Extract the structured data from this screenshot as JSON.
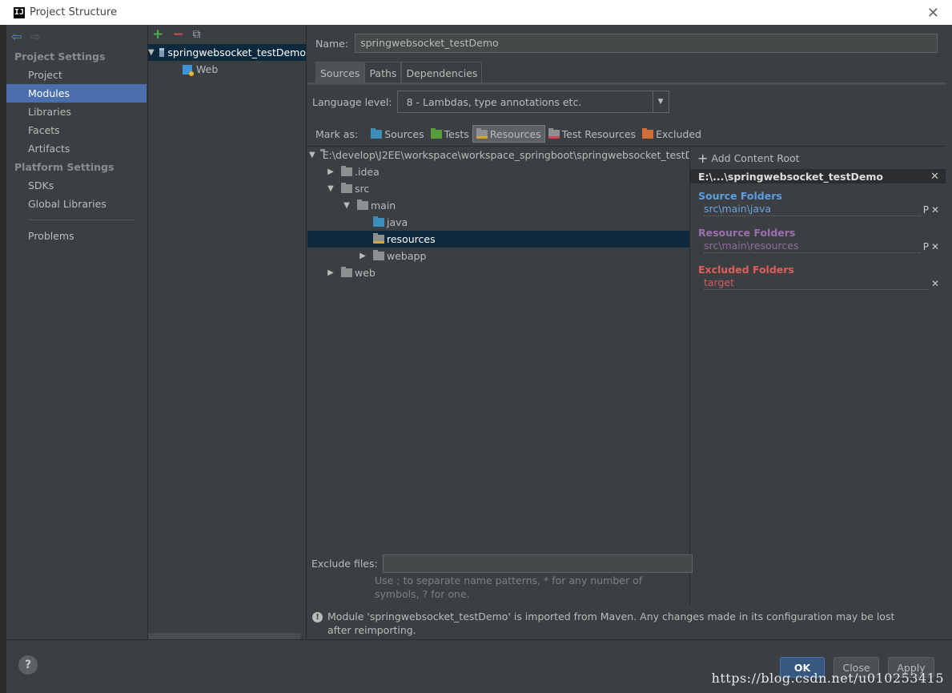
{
  "window": {
    "title": "Project Structure",
    "app_icon": "IJ"
  },
  "nav": {
    "sections": [
      {
        "title": "Project Settings",
        "items": [
          "Project",
          "Modules",
          "Libraries",
          "Facets",
          "Artifacts"
        ]
      },
      {
        "title": "Platform Settings",
        "items": [
          "SDKs",
          "Global Libraries"
        ]
      }
    ],
    "extra_items": [
      "Problems"
    ],
    "selected": "Modules"
  },
  "modules": {
    "toolbar": {
      "add": "+",
      "remove": "−",
      "copy": "⧉"
    },
    "tree": [
      {
        "label": "springwebsocket_testDemo",
        "expanded": true,
        "selected": true
      },
      {
        "label": "Web",
        "indent": 1
      }
    ]
  },
  "module": {
    "name_label": "Name:",
    "name_value": "springwebsocket_testDemo",
    "tabs": [
      "Sources",
      "Paths",
      "Dependencies"
    ],
    "active_tab": "Sources",
    "language_level_label": "Language level:",
    "language_level_value": "8 - Lambdas, type annotations etc.",
    "mark_as_label": "Mark as:",
    "mark_as": [
      "Sources",
      "Tests",
      "Resources",
      "Test Resources",
      "Excluded"
    ],
    "mark_as_selected": "Resources",
    "content_tree": [
      {
        "label": "E:\\develop\\J2EE\\workspace\\workspace_springboot\\springwebsocket_testD",
        "depth": 0,
        "toggle": "down"
      },
      {
        "label": ".idea",
        "depth": 1,
        "toggle": "right"
      },
      {
        "label": "src",
        "depth": 1,
        "toggle": "down"
      },
      {
        "label": "main",
        "depth": 2,
        "toggle": "down"
      },
      {
        "label": "java",
        "depth": 3,
        "toggle": "",
        "kind": "source"
      },
      {
        "label": "resources",
        "depth": 3,
        "toggle": "",
        "kind": "resource",
        "selected": true
      },
      {
        "label": "webapp",
        "depth": 3,
        "toggle": "right"
      },
      {
        "label": "web",
        "depth": 1,
        "toggle": "right"
      }
    ],
    "exclude_files_label": "Exclude files:",
    "exclude_files_value": "",
    "exclude_hint": "Use ; to separate name patterns, * for any number of symbols, ? for one.",
    "warning": "Module 'springwebsocket_testDemo' is imported from Maven. Any changes made in its configuration may be lost after reimporting."
  },
  "content_root": {
    "add_label": "Add Content Root",
    "root_path": "E:\\...\\springwebsocket_testDemo",
    "source_folders_title": "Source Folders",
    "source_folders": [
      "src\\main\\java"
    ],
    "resource_folders_title": "Resource Folders",
    "resource_folders": [
      "src\\main\\resources"
    ],
    "excluded_folders_title": "Excluded Folders",
    "excluded_folders": [
      "target"
    ],
    "colors": {
      "source": "#5c9fe6",
      "resource": "#9b6fb0",
      "excluded": "#e25c5c"
    }
  },
  "buttons": {
    "ok": "OK",
    "close": "Close",
    "apply": "Apply",
    "help": "?"
  },
  "watermark": "https://blog.csdn.net/u010253415",
  "colors": {
    "selection": "#4b6eaf",
    "tree_selection": "#0d293e",
    "background": "#3c3f41"
  }
}
